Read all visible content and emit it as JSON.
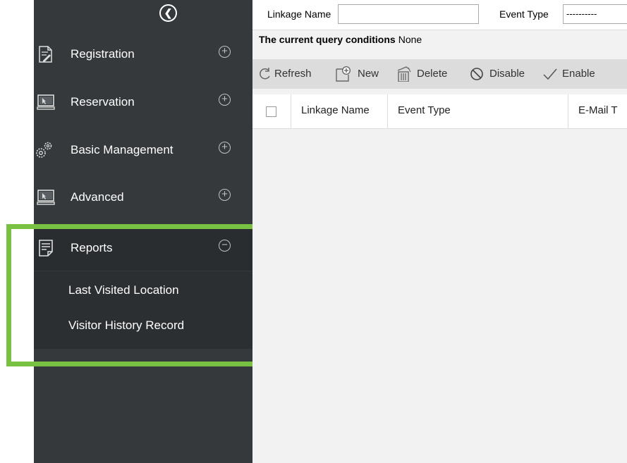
{
  "sidebar": {
    "collapse_icon": "chevron-left-circle-icon",
    "items": [
      {
        "label": "Registration",
        "icon": "registration-icon",
        "toggle": "+"
      },
      {
        "label": "Reservation",
        "icon": "reservation-icon",
        "toggle": "+"
      },
      {
        "label": "Basic Management",
        "icon": "gears-icon",
        "toggle": "+"
      },
      {
        "label": "Advanced",
        "icon": "monitor-icon",
        "toggle": "+"
      },
      {
        "label": "Reports",
        "icon": "report-icon",
        "toggle": "−"
      }
    ],
    "submenu": [
      "Last Visited Location",
      "Visitor History Record"
    ]
  },
  "filter": {
    "linkage_label": "Linkage Name",
    "linkage_value": "",
    "event_label": "Event Type",
    "event_value": "----------"
  },
  "query": {
    "label": "The current query conditions",
    "value": "None"
  },
  "toolbar": {
    "refresh": "Refresh",
    "new": "New",
    "delete": "Delete",
    "disable": "Disable",
    "enable": "Enable"
  },
  "table": {
    "columns": [
      "Linkage Name",
      "Event Type",
      "E-Mail T"
    ]
  },
  "colors": {
    "sidebar_bg": "#35393c",
    "highlight_border": "#79c143",
    "toolbar_bg": "#dcdcdc"
  }
}
